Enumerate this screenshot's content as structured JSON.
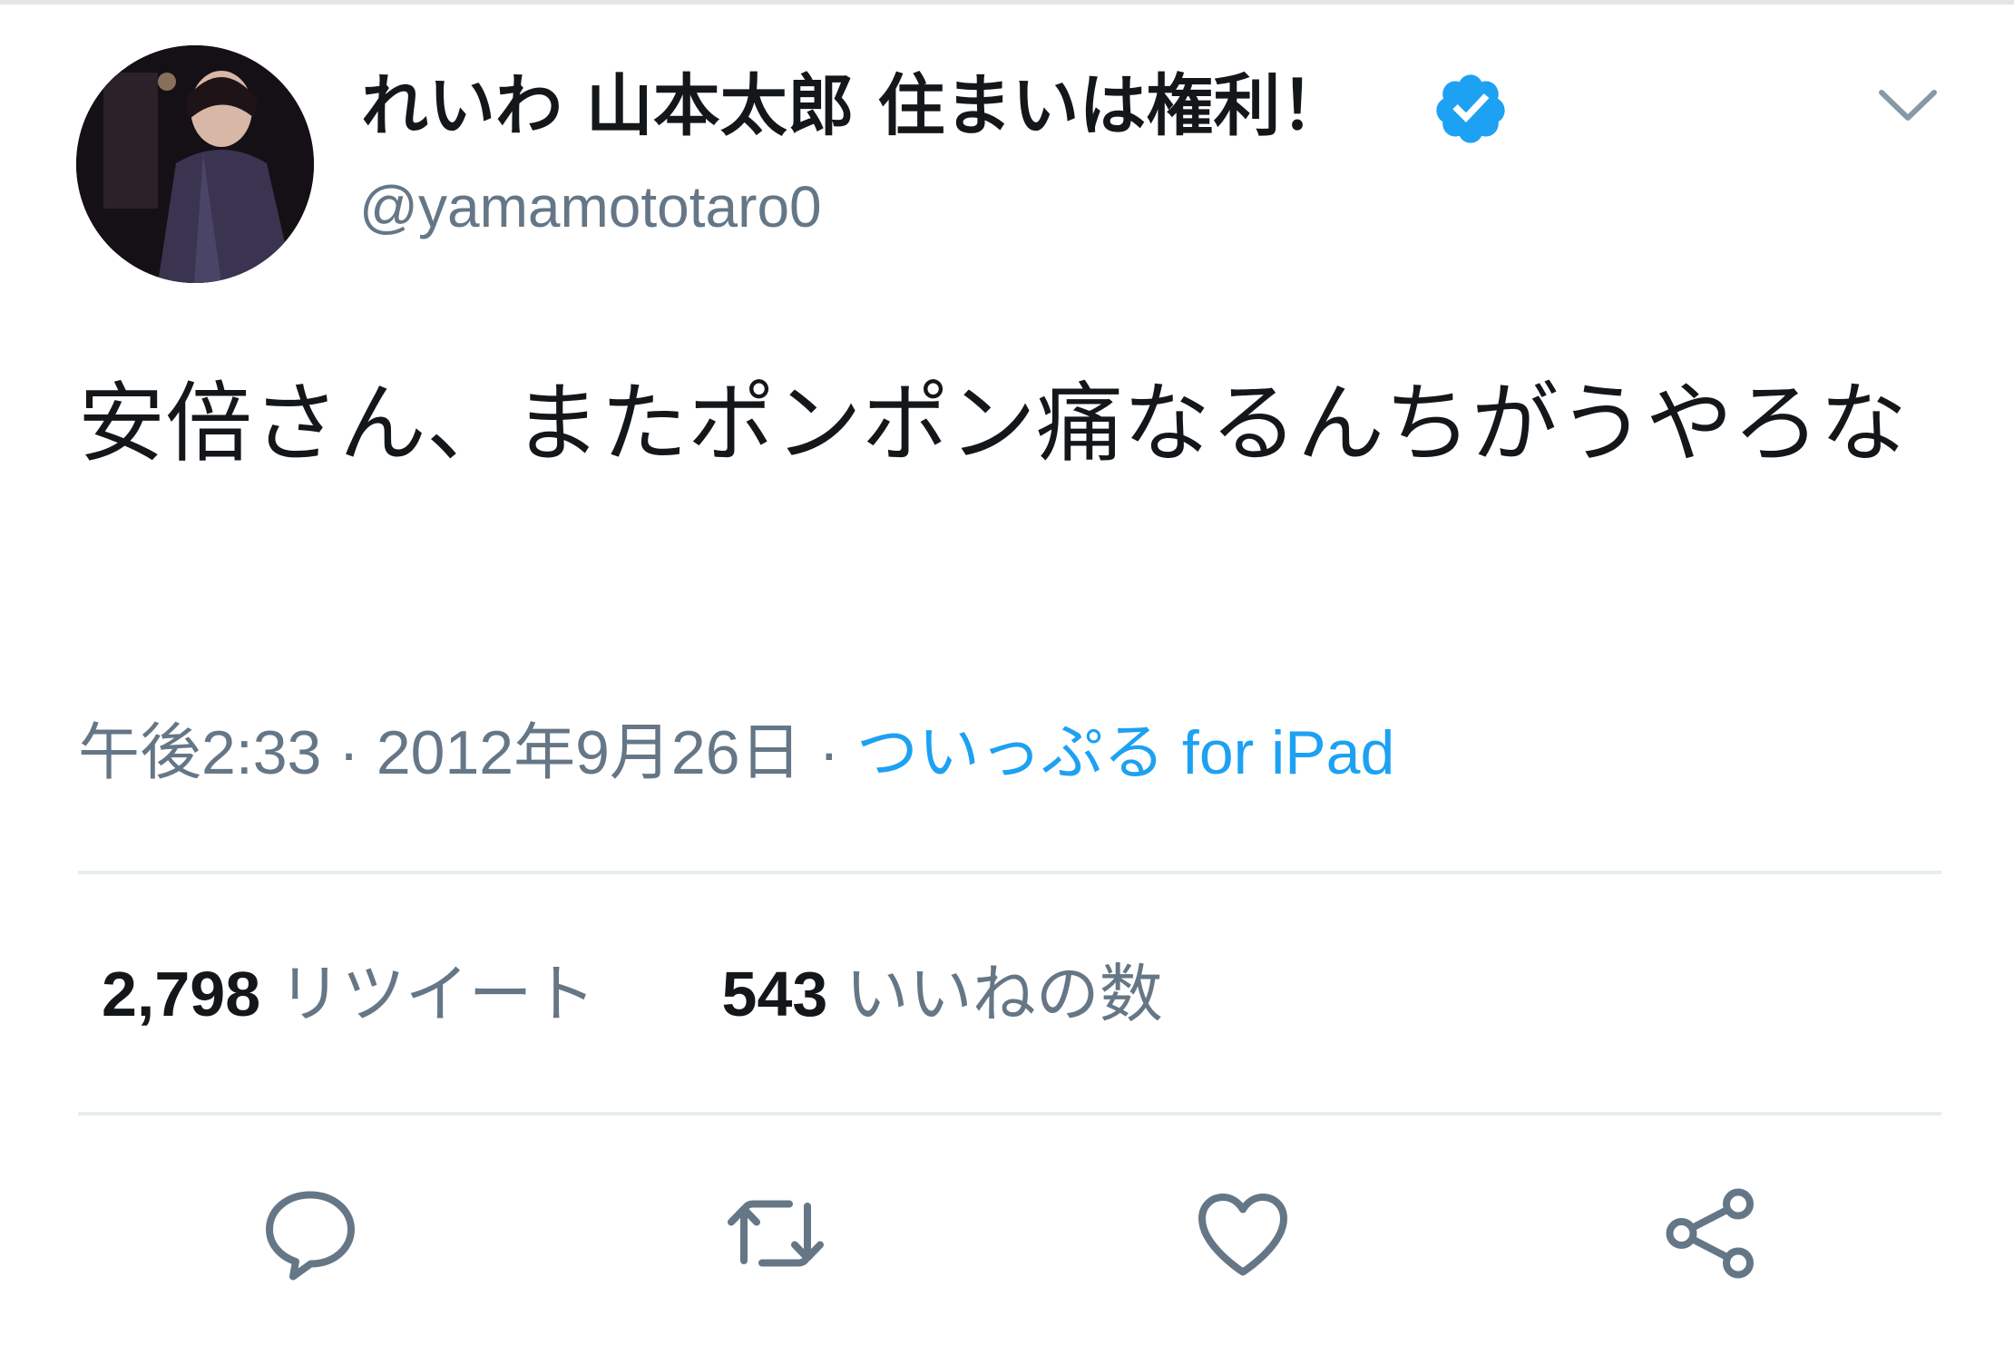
{
  "user": {
    "display_name": "れいわ 山本太郎 住まいは権利！",
    "handle": "@yamamototaro0",
    "verified": true
  },
  "tweet": {
    "text": "安倍さん、またポンポン痛なるんちがうやろな",
    "time": "午後2:33",
    "date": "2012年9月26日",
    "separator": "·",
    "source": "ついっぷる for iPad"
  },
  "stats": {
    "retweets_count": "2,798",
    "retweets_label": "リツイート",
    "likes_count": "543",
    "likes_label": "いいねの数"
  },
  "colors": {
    "text": "#14171a",
    "secondary": "#657786",
    "accent": "#1da1f2",
    "divider": "#e6ecf0"
  },
  "icons": [
    "verified-badge-icon",
    "chevron-down-icon",
    "reply-icon",
    "retweet-icon",
    "like-icon",
    "share-icon"
  ]
}
